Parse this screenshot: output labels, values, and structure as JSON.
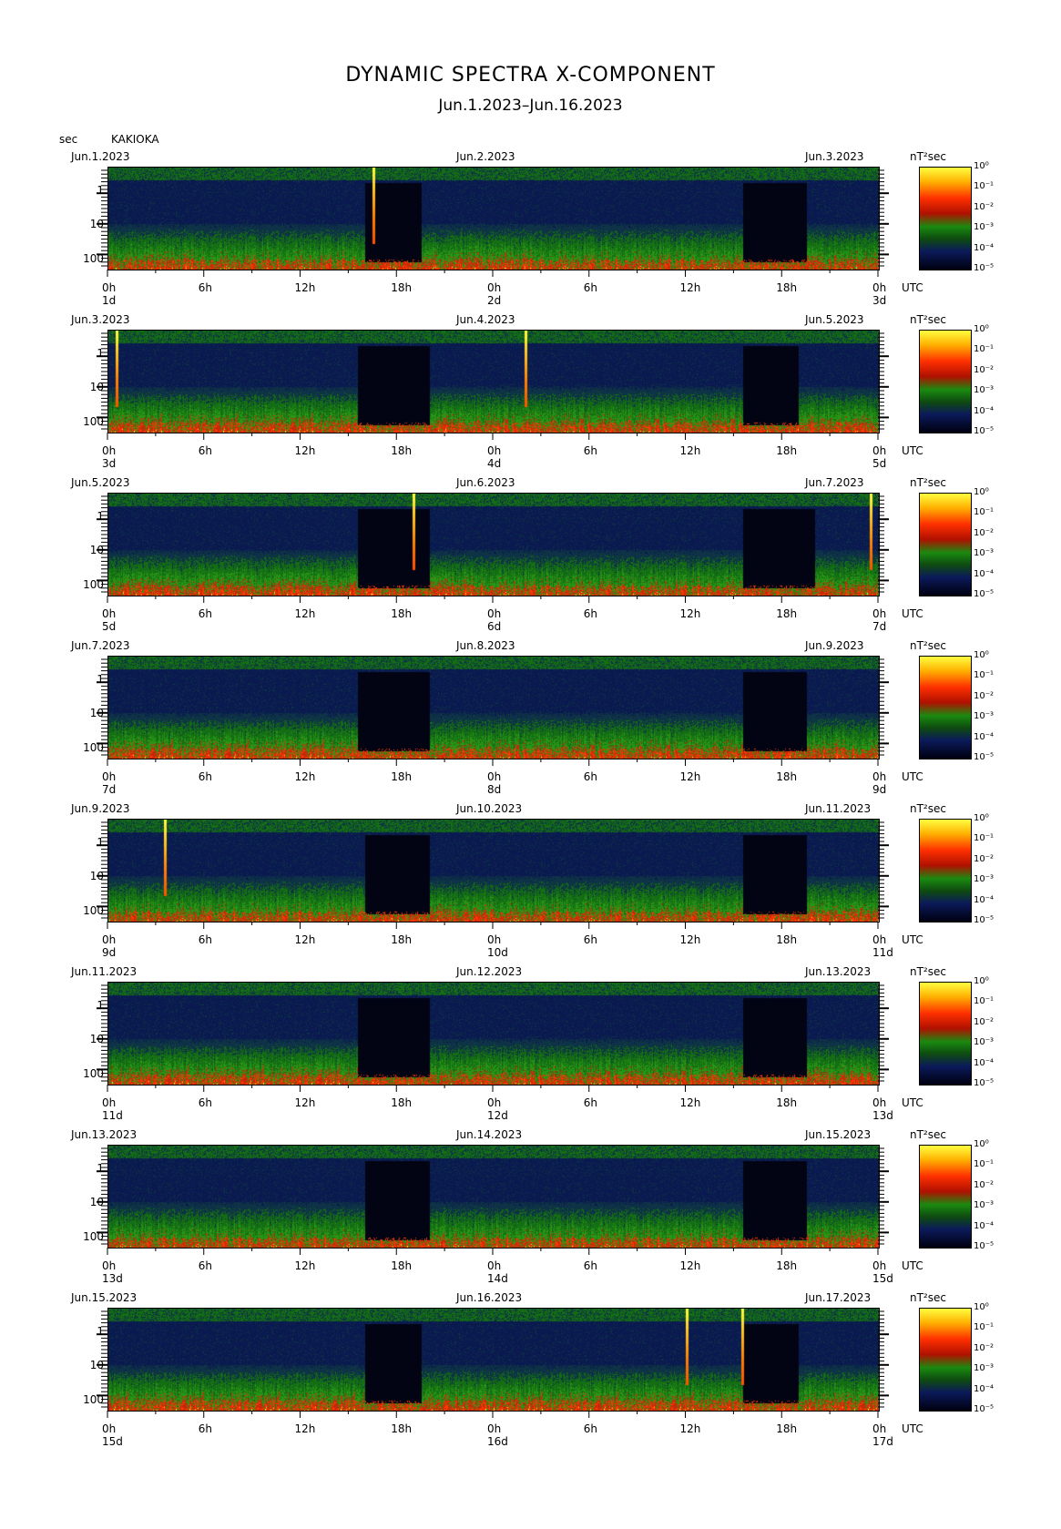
{
  "title": "DYNAMIC SPECTRA X-COMPONENT",
  "subtitle": "Jun.1.2023–Jun.16.2023",
  "y_unit": "sec",
  "station": "KAKIOKA",
  "colorbar_unit": "nT²sec",
  "colorbar_ticks": [
    "10⁰",
    "10⁻¹",
    "10⁻²",
    "10⁻³",
    "10⁻⁴",
    "10⁻⁵"
  ],
  "time_ticks": [
    "0h",
    "6h",
    "12h",
    "18h",
    "0h",
    "6h",
    "12h",
    "18h",
    "0h"
  ],
  "utc_label": "UTC",
  "period_ticks": [
    "1",
    "10",
    "100"
  ],
  "chart_data": {
    "type": "heatmap",
    "title": "DYNAMIC SPECTRA X-COMPONENT",
    "subtitle": "Jun.1.2023–Jun.16.2023",
    "ylabel": "sec",
    "ylim": [
      1,
      100
    ],
    "y_scale": "log",
    "colorscale_label": "nT²sec",
    "colorscale_range": [
      "10⁻⁵",
      "10⁰"
    ],
    "panels": [
      {
        "start": "Jun.1.2023",
        "mid": "Jun.2.2023",
        "end": "Jun.3.2023",
        "days": [
          "1d",
          "2d",
          "3d"
        ],
        "spikes_h": [
          16.5
        ],
        "quiet_h": [
          [
            16,
            19.5
          ],
          [
            39.5,
            43.5
          ]
        ]
      },
      {
        "start": "Jun.3.2023",
        "mid": "Jun.4.2023",
        "end": "Jun.5.2023",
        "days": [
          "3d",
          "4d",
          "5d"
        ],
        "spikes_h": [
          0.5,
          26
        ],
        "quiet_h": [
          [
            15.5,
            20
          ],
          [
            39.5,
            43
          ]
        ]
      },
      {
        "start": "Jun.5.2023",
        "mid": "Jun.6.2023",
        "end": "Jun.7.2023",
        "days": [
          "5d",
          "6d",
          "7d"
        ],
        "spikes_h": [
          19,
          47.5
        ],
        "quiet_h": [
          [
            15.5,
            20
          ],
          [
            39.5,
            44
          ]
        ]
      },
      {
        "start": "Jun.7.2023",
        "mid": "Jun.8.2023",
        "end": "Jun.9.2023",
        "days": [
          "7d",
          "8d",
          "9d"
        ],
        "spikes_h": [],
        "quiet_h": [
          [
            15.5,
            20
          ],
          [
            39.5,
            43.5
          ]
        ]
      },
      {
        "start": "Jun.9.2023",
        "mid": "Jun.10.2023",
        "end": "Jun.11.2023",
        "days": [
          "9d",
          "10d",
          "11d"
        ],
        "spikes_h": [
          3.5
        ],
        "quiet_h": [
          [
            16,
            20
          ],
          [
            39.5,
            43.5
          ]
        ]
      },
      {
        "start": "Jun.11.2023",
        "mid": "Jun.12.2023",
        "end": "Jun.13.2023",
        "days": [
          "11d",
          "12d",
          "13d"
        ],
        "spikes_h": [],
        "quiet_h": [
          [
            15.5,
            20
          ],
          [
            39.5,
            43.5
          ]
        ]
      },
      {
        "start": "Jun.13.2023",
        "mid": "Jun.14.2023",
        "end": "Jun.15.2023",
        "days": [
          "13d",
          "14d",
          "15d"
        ],
        "spikes_h": [],
        "quiet_h": [
          [
            16,
            20
          ],
          [
            39.5,
            43.5
          ]
        ]
      },
      {
        "start": "Jun.15.2023",
        "mid": "Jun.16.2023",
        "end": "Jun.17.2023",
        "days": [
          "15d",
          "16d",
          "17d"
        ],
        "spikes_h": [
          36,
          39.5
        ],
        "quiet_h": [
          [
            16,
            19.5
          ],
          [
            39.5,
            43
          ]
        ]
      }
    ]
  }
}
